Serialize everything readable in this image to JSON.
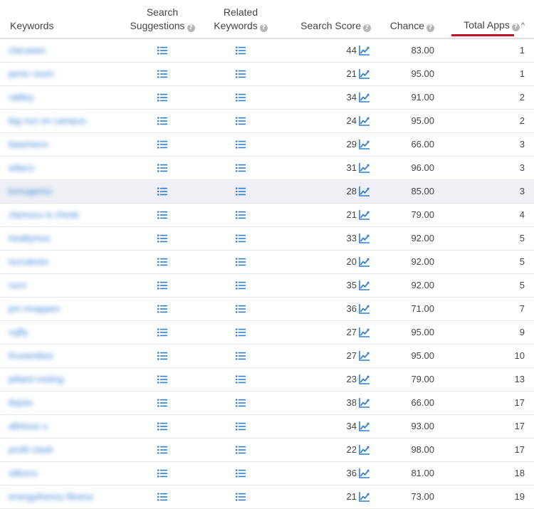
{
  "columns": {
    "keywords": "Keywords",
    "search_suggestions_line1": "Search",
    "search_suggestions_line2": "Suggestions",
    "related_keywords_line1": "Related",
    "related_keywords_line2": "Keywords",
    "search_score": "Search Score",
    "chance": "Chance",
    "total_apps": "Total Apps",
    "help_glyph": "?",
    "sort_glyph": "^"
  },
  "icons": {
    "list": "list-icon",
    "trend": "trend-chart-icon",
    "help": "help-icon",
    "accent_color": "#2f7fd0",
    "sort_underline_color": "#c8102e"
  },
  "rows": [
    {
      "keyword": "claruweo",
      "score": "44",
      "chance": "83.00",
      "apps": "1"
    },
    {
      "keyword": "jamic room",
      "score": "21",
      "chance": "95.00",
      "apps": "1"
    },
    {
      "keyword": "rattley",
      "score": "34",
      "chance": "91.00",
      "apps": "2"
    },
    {
      "keyword": "big roci on campus",
      "score": "24",
      "chance": "95.00",
      "apps": "2"
    },
    {
      "keyword": "bawmeco",
      "score": "29",
      "chance": "66.00",
      "apps": "3"
    },
    {
      "keyword": "wilaco",
      "score": "31",
      "chance": "96.00",
      "apps": "3"
    },
    {
      "keyword": "lomugemo",
      "score": "28",
      "chance": "85.00",
      "apps": "3"
    },
    {
      "keyword": "clamocu is chosk",
      "score": "21",
      "chance": "79.00",
      "apps": "4"
    },
    {
      "keyword": "healtymoc",
      "score": "33",
      "chance": "92.00",
      "apps": "5"
    },
    {
      "keyword": "lucrutesto",
      "score": "20",
      "chance": "92.00",
      "apps": "5"
    },
    {
      "keyword": "rucn",
      "score": "35",
      "chance": "92.00",
      "apps": "5"
    },
    {
      "keyword": "jen mrappen",
      "score": "36",
      "chance": "71.00",
      "apps": "7"
    },
    {
      "keyword": "rujfly",
      "score": "27",
      "chance": "95.00",
      "apps": "9"
    },
    {
      "keyword": "lirusembes",
      "score": "27",
      "chance": "95.00",
      "apps": "10"
    },
    {
      "keyword": "jellard rosting",
      "score": "23",
      "chance": "79.00",
      "apps": "13"
    },
    {
      "keyword": "ltejoio",
      "score": "38",
      "chance": "66.00",
      "apps": "17"
    },
    {
      "keyword": "allnloon s",
      "score": "34",
      "chance": "93.00",
      "apps": "17"
    },
    {
      "keyword": "profit clash",
      "score": "22",
      "chance": "98.00",
      "apps": "17"
    },
    {
      "keyword": "stikoco",
      "score": "36",
      "chance": "81.00",
      "apps": "18"
    },
    {
      "keyword": "energythency fitness",
      "score": "21",
      "chance": "73.00",
      "apps": "19"
    }
  ]
}
